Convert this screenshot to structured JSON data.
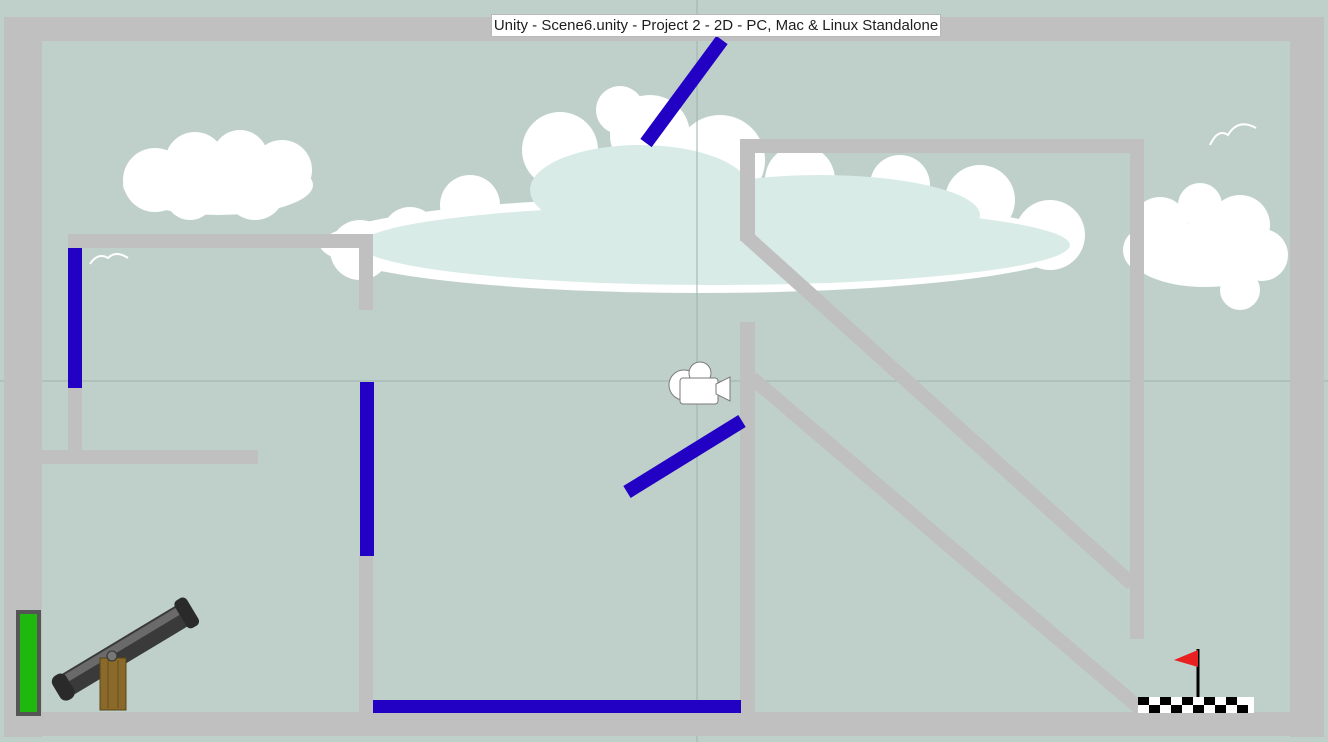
{
  "window": {
    "title": "Unity - Scene6.unity - Project 2 - 2D - PC, Mac & Linux Standalone"
  },
  "scene": {
    "background_color": "#bfd0ca",
    "wall_color": "#c0c0c0",
    "platform_color": "#2200c4",
    "cloud_color": "#ffffff",
    "cloud_inner_color": "#d8ebe6",
    "gridline_color": "#9cb2ac"
  },
  "objects": {
    "cannon": {
      "icon": "cannon-icon",
      "barrel_color": "#404040",
      "stand_color": "#8a6a2a"
    },
    "power_meter": {
      "icon": "power-meter",
      "level": 1.0,
      "fill_color": "#1eb80e",
      "frame_color": "#555555"
    },
    "goal": {
      "icon": "goal-flag-icon",
      "flag_color": "#e82020"
    },
    "camera": {
      "icon": "camera-gizmo-icon"
    },
    "birds": {
      "icon": "bird-icon"
    }
  }
}
